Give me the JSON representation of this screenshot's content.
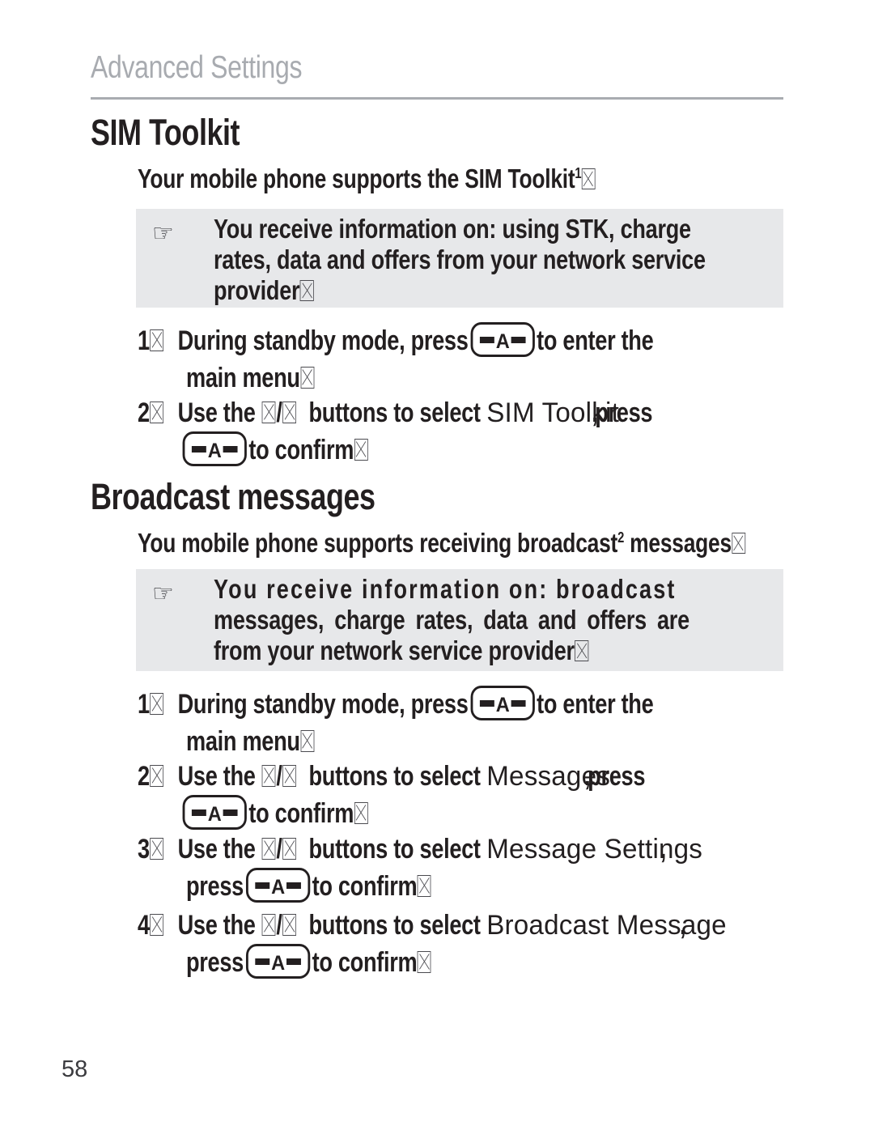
{
  "page": {
    "running_header": "Advanced Settings",
    "page_number": "58"
  },
  "icons": {
    "pointing_hand": "☞",
    "missing_glyph": "tofu-box",
    "key_ok": "-A-"
  },
  "sections": [
    {
      "id": "sim-toolkit",
      "heading": "SIM Toolkit",
      "intro_prefix": "Your mobile phone supports the SIM Toolkit",
      "intro_superscript": "1",
      "note": {
        "lines": [
          "You receive information on: using STK, charge",
          "rates, data and offers from your network service",
          "provider"
        ]
      },
      "steps": [
        {
          "number": "1",
          "line1_before_key": "During standby mode, press",
          "line1_after_key": "to enter the",
          "line2": "main menu"
        },
        {
          "number": "2",
          "prefix": "Use the",
          "middle": "buttons to select",
          "menu_name": "SIM Toolkit",
          "after_menu": "press",
          "confirm_before_key": "",
          "confirm_after_key": "to confirm"
        }
      ]
    },
    {
      "id": "broadcast-messages",
      "heading": "Broadcast messages",
      "intro_prefix": "You mobile phone supports receiving broadcast",
      "intro_superscript": "2",
      "intro_suffix": " messages",
      "note": {
        "lines": [
          "You receive information on: broadcast",
          "messages, charge rates, data and offers are",
          "from your network service provider"
        ]
      },
      "steps": [
        {
          "number": "1",
          "line1_before_key": "During standby mode, press",
          "line1_after_key": "to enter the",
          "line2": "main menu"
        },
        {
          "number": "2",
          "prefix": "Use the",
          "middle": "buttons to select",
          "menu_name": "Messages",
          "after_menu": "press",
          "confirm_before_key": "",
          "confirm_after_key": "to confirm"
        },
        {
          "number": "3",
          "prefix": "Use the",
          "middle": "buttons to select",
          "menu_name": "Message Settings",
          "after_menu": "",
          "confirm_before_key": "press",
          "confirm_after_key": "to confirm"
        },
        {
          "number": "4",
          "prefix": "Use the",
          "middle": "buttons to select",
          "menu_name": "Broadcast Message",
          "after_menu": "",
          "confirm_before_key": "press",
          "confirm_after_key": "to confirm"
        }
      ]
    }
  ],
  "separators": {
    "slash": "/",
    "comma": ","
  }
}
